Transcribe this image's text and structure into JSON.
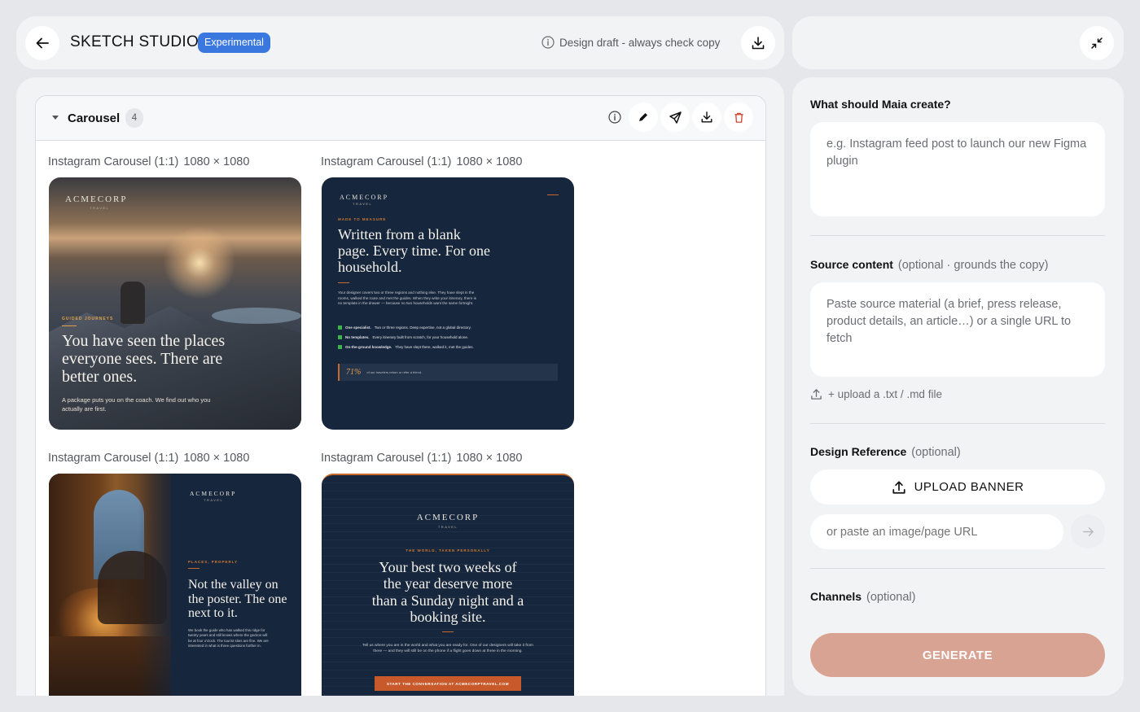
{
  "header": {
    "title": "SKETCH STUDIO",
    "badge": "Experimental",
    "draft_note": "Design draft - always check copy"
  },
  "carousel": {
    "title": "Carousel",
    "count": "4",
    "items": [
      {
        "label": "Instagram Carousel (1:1)",
        "dims": "1080 × 1080",
        "logo": "ACMECORP",
        "logo_sub": "TRAVEL",
        "kicker": "GUIDED JOURNEYS",
        "headline": "You have seen the places everyone sees. There are better ones.",
        "body": "A package puts you on the coach. We find out who you actually are first."
      },
      {
        "label": "Instagram Carousel (1:1)",
        "dims": "1080 × 1080",
        "logo": "ACMECORP",
        "logo_sub": "TRAVEL",
        "kicker": "MADE TO MEASURE",
        "headline": "Written from a blank page. Every time. For one household.",
        "body": "Your designer covers two or three regions and nothing else. They have slept in the rooms, walked the route and met the guides. When they write your itinerary, there is no template in the drawer — because no two households want the same fortnight.",
        "bullets": [
          {
            "bold": "One specialist.",
            "text": "Two or three regions. Deep expertise, not a global directory."
          },
          {
            "bold": "No templates.",
            "text": "Every itinerary built from scratch, for your household alone."
          },
          {
            "bold": "On-the-ground knowledge.",
            "text": "They have slept there, walked it, met the guides."
          }
        ],
        "stat": "71%",
        "stat_text": "of our travelers return or refer a friend."
      },
      {
        "label": "Instagram Carousel (1:1)",
        "dims": "1080 × 1080",
        "logo": "ACMECORP",
        "logo_sub": "TRAVEL",
        "kicker": "PLACES, PROPERLY",
        "headline": "Not the valley on the poster. The one next to it.",
        "body": "We book the guide who has walked this ridge for twenty years and still knows where the geckos will be at four o'clock. The tourist sites are fine. We are interested in what is three questions further in."
      },
      {
        "label": "Instagram Carousel (1:1)",
        "dims": "1080 × 1080",
        "logo": "ACMECORP",
        "logo_sub": "TRAVEL",
        "kicker": "THE WORLD, TAKEN PERSONALLY",
        "headline": "Your best two weeks of the year deserve more than a Sunday night and a booking site.",
        "body": "Tell us where you are in the world and what you are ready for. One of our designers will take it from there — and they will still be on the phone if a flight goes down at three in the morning.",
        "cta": "START THE CONVERSATION AT ACMECORPTRAVEL.COM"
      }
    ]
  },
  "side": {
    "create_title": "What should Maia create?",
    "create_placeholder": "e.g. Instagram feed post to launch our new Figma plugin",
    "source_title": "Source content",
    "source_optional": "(optional · grounds the copy)",
    "source_placeholder": "Paste source material (a brief, press release, product details, an article…) or a single URL to fetch",
    "upload_file": "+ upload a .txt / .md file",
    "design_title": "Design Reference",
    "design_optional": "(optional)",
    "upload_banner": "UPLOAD BANNER",
    "url_placeholder": "or paste an image/page URL",
    "channels_title": "Channels",
    "channels_optional": "(optional)",
    "generate": "GENERATE"
  },
  "colors": {
    "accent_blue": "#3a78e0",
    "generate": "#d9a393",
    "thumb_navy": "#16263d",
    "thumb_orange": "#c8692b",
    "delete_red": "#d0442e"
  }
}
